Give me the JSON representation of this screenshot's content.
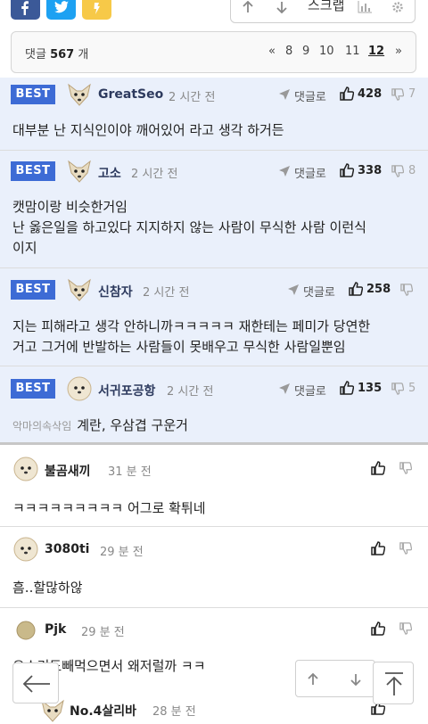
{
  "share": {
    "icons": [
      "facebook-icon",
      "twitter-icon",
      "kakaostory-icon"
    ],
    "scrap_label": "스크랩"
  },
  "pager": {
    "count_prefix": "댓글",
    "count": "567",
    "count_suffix": "개",
    "first_icon": "«",
    "pages": [
      "8",
      "9",
      "10",
      "11",
      "12"
    ],
    "current_page": "12",
    "next_icon": "»"
  },
  "labels": {
    "best": "BEST",
    "reply": "댓글로"
  },
  "best_comments": [
    {
      "nick": "GreatSeo",
      "time": "2 시간 전",
      "likes": "428",
      "dislikes": "7",
      "text": "대부분 난 지식인이야 깨어있어 라고 생각 하거든"
    },
    {
      "nick": "고소",
      "time": "2 시간 전",
      "likes": "338",
      "dislikes": "8",
      "text": "캣맘이랑 비슷한거임\n난 옳은일을 하고있다 지지하지 않는 사람이 무식한 사람 이런식\n이지"
    },
    {
      "nick": "신참자",
      "time": "2 시간 전",
      "likes": "258",
      "dislikes": "",
      "text": "지는 피해라고 생각 안하니까ㅋㅋㅋㅋㅋ 재한테는 페미가 당연한\n거고 그거에 반발하는 사람들이 못배우고 무식한 사람일뿐임"
    },
    {
      "nick": "서귀포공항",
      "time": "2 시간 전",
      "likes": "135",
      "dislikes": "5",
      "quote": "악마의속삭임",
      "text": "계란, 우삼겹 구운거"
    }
  ],
  "comments": [
    {
      "nick": "불곰새끼",
      "time": "31 분 전",
      "text": "ㅋㅋㅋㅋㅋㅋㅋㅋㅋ 어그로 확튀네"
    },
    {
      "nick": "3080ti",
      "time": "29 분 전",
      "text": "흠..할많하않"
    },
    {
      "nick": "Pjk",
      "time": "29 분 전",
      "text": "오소리도빼먹으면서 왜저럴까 ㅋㅋ"
    },
    {
      "nick": "No.4살리바",
      "time": "28 분 전",
      "text": ""
    }
  ]
}
